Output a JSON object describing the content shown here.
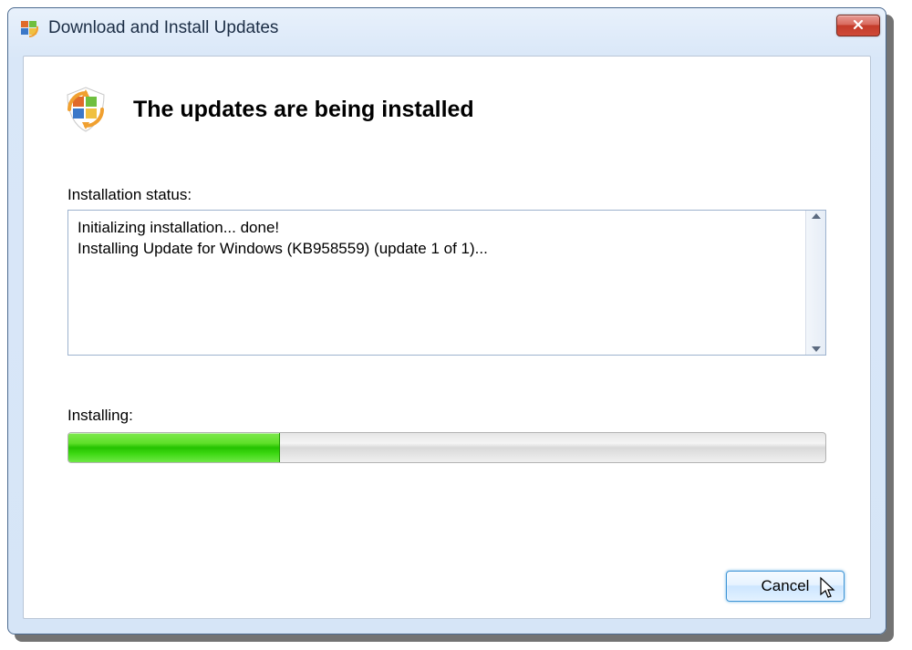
{
  "window": {
    "title": "Download and Install Updates"
  },
  "main": {
    "heading": "The updates are being installed",
    "status_label": "Installation status:",
    "status_text": "Initializing installation... done!\nInstalling Update for Windows (KB958559) (update 1 of 1)... ",
    "installing_label": "Installing:",
    "progress_percent": 28
  },
  "buttons": {
    "cancel": "Cancel"
  }
}
